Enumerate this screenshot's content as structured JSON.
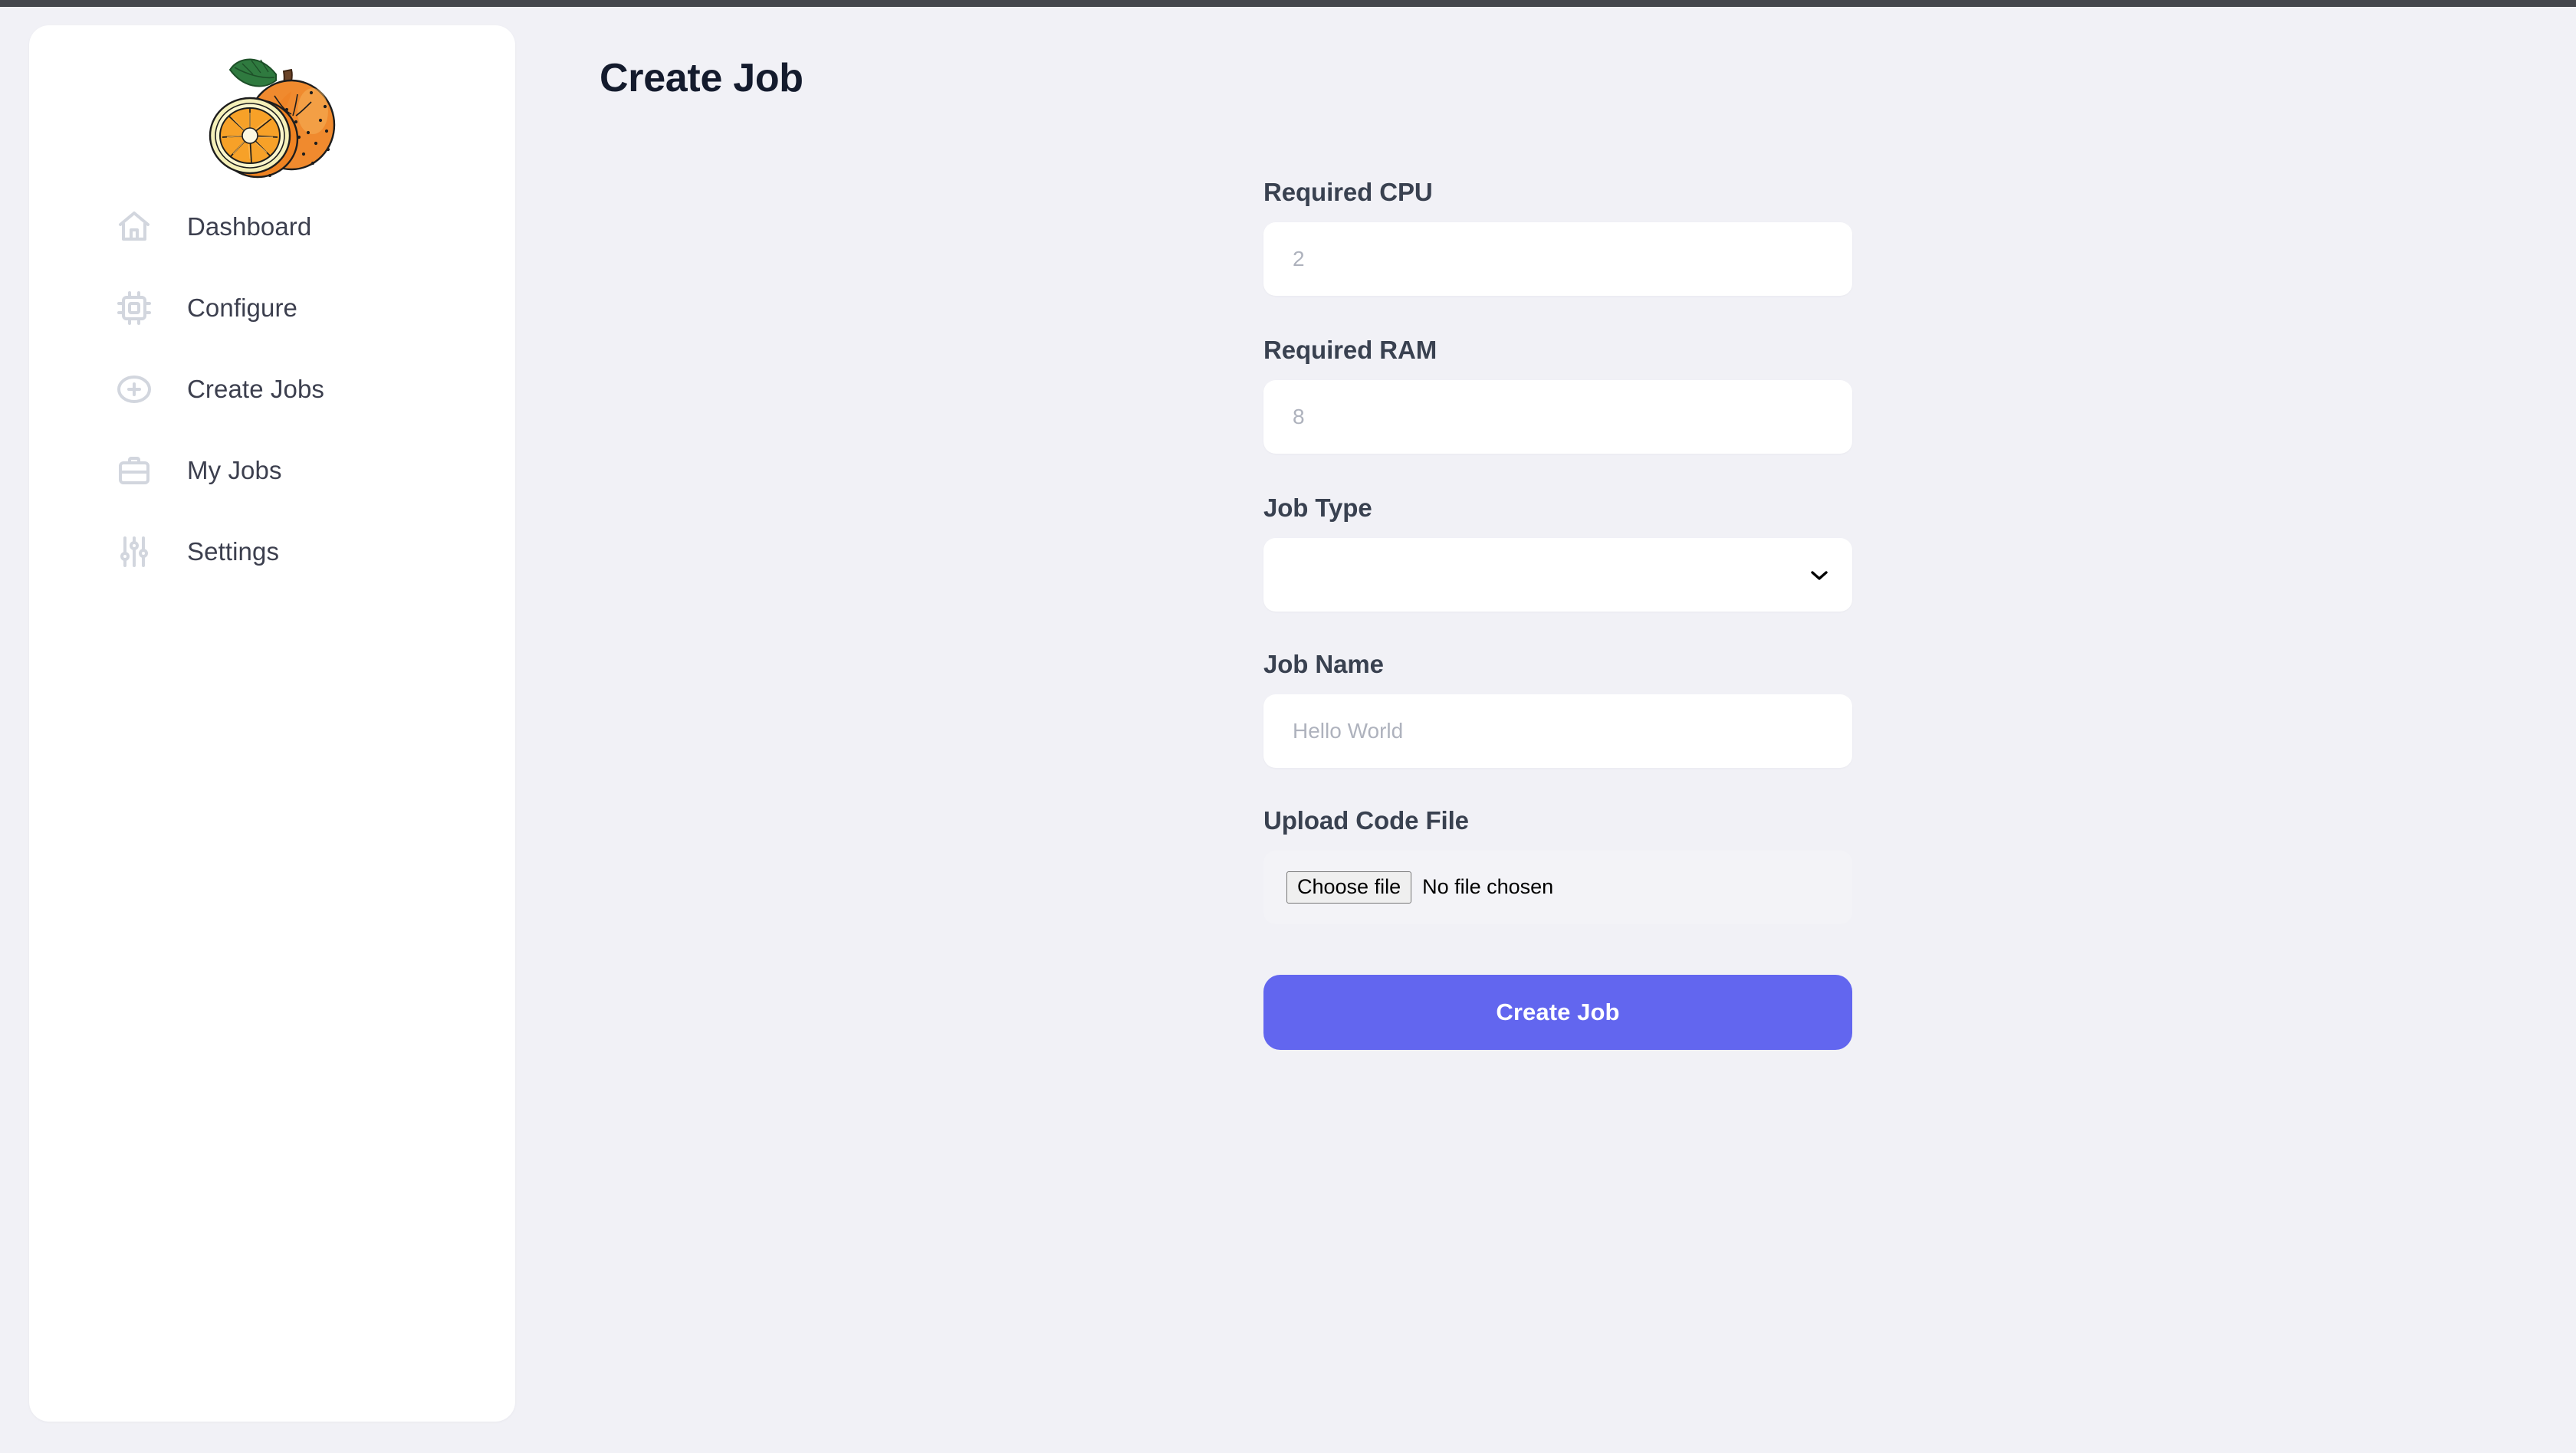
{
  "app": {
    "logo_alt": "orange-fruit-logo",
    "accent_color": "#6266EF",
    "page_background": "#F1F1F6",
    "card_background": "#FFFFFF",
    "label_color": "#394150",
    "title_color": "#141B2D",
    "nav_icon_color": "#D2D6DE"
  },
  "sidebar": {
    "items": [
      {
        "label": "Dashboard",
        "icon": "home-icon"
      },
      {
        "label": "Configure",
        "icon": "cpu-chip-icon"
      },
      {
        "label": "Create Jobs",
        "icon": "plus-circle-icon"
      },
      {
        "label": "My Jobs",
        "icon": "briefcase-icon"
      },
      {
        "label": "Settings",
        "icon": "sliders-icon"
      }
    ]
  },
  "main": {
    "title": "Create Job",
    "form": {
      "cpu": {
        "label": "Required CPU",
        "placeholder": "2",
        "value": ""
      },
      "ram": {
        "label": "Required RAM",
        "placeholder": "8",
        "value": ""
      },
      "job_type": {
        "label": "Job Type",
        "selected": "",
        "chevron": "chevron-down-icon"
      },
      "job_name": {
        "label": "Job Name",
        "placeholder": "Hello World",
        "value": ""
      },
      "upload": {
        "label": "Upload Code File",
        "button_label": "Choose file",
        "status_text": "No file chosen"
      },
      "submit_label": "Create Job"
    }
  }
}
